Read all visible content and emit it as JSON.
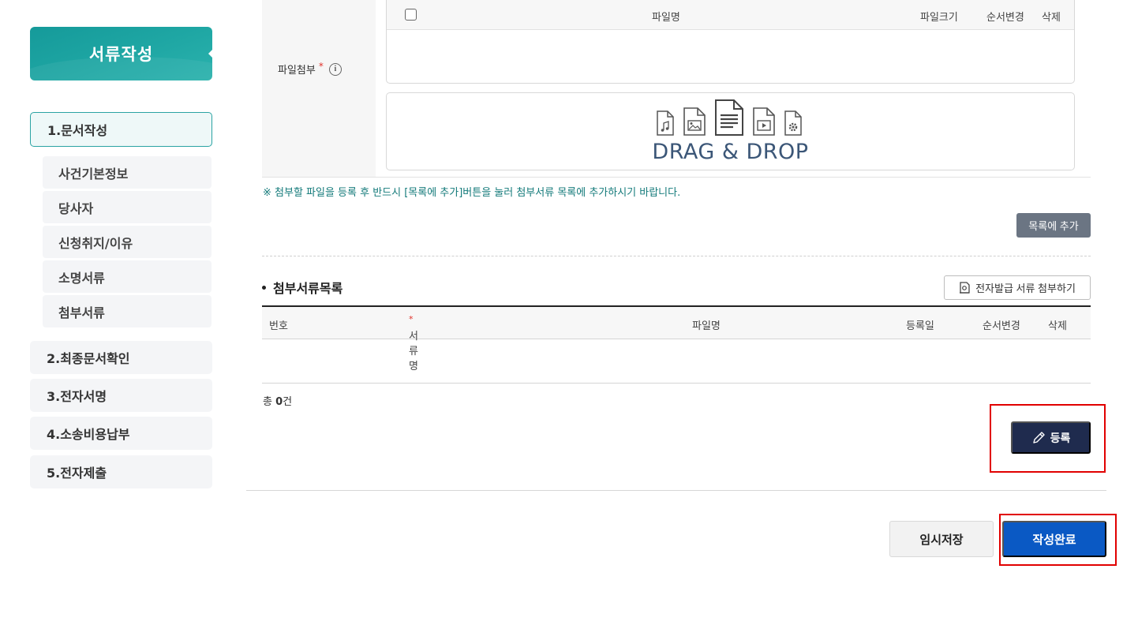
{
  "sidebar": {
    "title": "서류작성",
    "steps": [
      {
        "label": "1.문서작성",
        "active": true
      },
      {
        "label": "2.최종문서확인"
      },
      {
        "label": "3.전자서명"
      },
      {
        "label": "4.소송비용납부"
      },
      {
        "label": "5.전자제출"
      }
    ],
    "substeps": [
      "사건기본정보",
      "당사자",
      "신청취지/이유",
      "소명서류",
      "첨부서류"
    ]
  },
  "attach": {
    "label": "파일첨부",
    "required_mark": "*",
    "info_icon": "i",
    "columns": {
      "name": "파일명",
      "size": "파일크기",
      "order": "순서변경",
      "delete": "삭제"
    },
    "drop_text": "DRAG & DROP",
    "notice": "※ 첨부할 파일을 등록 후 반드시 [목록에 추가]버튼을 눌러 첨부서류 목록에 추가하시기 바랍니다.",
    "add_button": "목록에 추가"
  },
  "doclist": {
    "title": "첨부서류목록",
    "ebutton": "전자발급 서류 첨부하기",
    "columns": {
      "no": "번호",
      "docname": "서류명",
      "docname_req": "*",
      "filename": "파일명",
      "date": "등록일",
      "order": "순서변경",
      "delete": "삭제"
    },
    "total_prefix": "총",
    "total_count": "0",
    "total_suffix": "건",
    "register_button": "등록"
  },
  "footer": {
    "temp_save": "임시저장",
    "complete": "작성완료"
  },
  "colors": {
    "accent_teal": "#1fa7a4",
    "navy": "#1f2b4e",
    "primary_blue": "#0a59c4",
    "highlight_red": "#e10000"
  }
}
